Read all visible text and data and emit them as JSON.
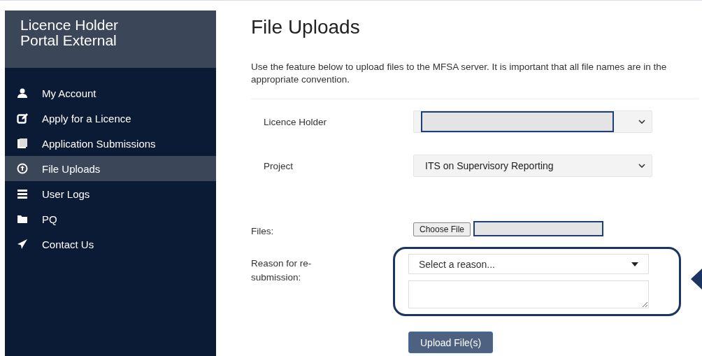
{
  "sidebar": {
    "title": "Licence Holder Portal External",
    "items": [
      {
        "label": "My Account",
        "selected": false
      },
      {
        "label": "Apply for a Licence",
        "selected": false
      },
      {
        "label": "Application Submissions",
        "selected": false
      },
      {
        "label": "File Uploads",
        "selected": true
      },
      {
        "label": "User Logs",
        "selected": false
      },
      {
        "label": "PQ",
        "selected": false
      },
      {
        "label": "Contact Us",
        "selected": false
      }
    ]
  },
  "page": {
    "title": "File Uploads",
    "description": "Use the feature below to upload files to the MFSA server. It is important that all file names are in the appropriate convention."
  },
  "form": {
    "licence_holder": {
      "label": "Licence Holder"
    },
    "project": {
      "label": "Project",
      "value": "ITS on Supervisory Reporting"
    },
    "files": {
      "label": "Files:",
      "button": "Choose File"
    },
    "reason": {
      "label": "Reason for re-submission:",
      "placeholder": "Select a reason..."
    },
    "submit": "Upload File(s)"
  }
}
